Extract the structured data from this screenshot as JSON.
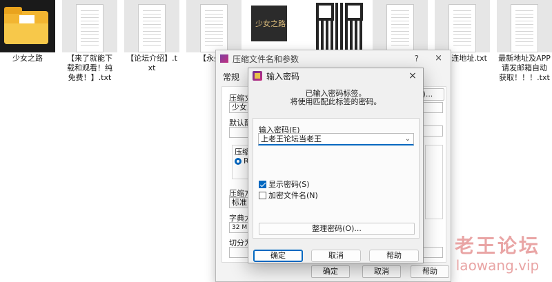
{
  "desktop": {
    "files": [
      {
        "name": "少女之路",
        "kind": "folder"
      },
      {
        "name": "【来了就能下载和观看！纯免费！】.txt",
        "kind": "txt"
      },
      {
        "name": "【论坛介绍】.txt",
        "kind": "txt"
      },
      {
        "name": "【永久地址发布页】.txt",
        "label_visible": "【永久地",
        "kind": "txt"
      },
      {
        "name": "poster",
        "kind": "image"
      },
      {
        "name": "qr",
        "kind": "image"
      },
      {
        "name": "",
        "kind": "txt"
      },
      {
        "name": "连地址.txt",
        "kind": "txt"
      },
      {
        "name": "最新地址及APP请发邮箱自动获取！！！.txt",
        "kind": "txt"
      }
    ],
    "poster_text": "少女之路"
  },
  "back_dialog": {
    "title": "压缩文件名和参数",
    "help_glyph": "?",
    "close_glyph": "×",
    "tab": "常规",
    "archive_label": "压缩文",
    "archive_value": "少女之",
    "browse_button": "(B)...",
    "profile_label": "默认配",
    "format_label": "压缩文",
    "format_radio": "RA",
    "method_label": "压缩方",
    "method_value": "标准",
    "dict_label": "字典大",
    "dict_value": "32 MB",
    "split_label": "切分为",
    "ok": "确定",
    "cancel": "取消",
    "help": "帮助"
  },
  "dialog": {
    "title": "输入密码",
    "close_glyph": "×",
    "message_line1": "已输入密码标签。",
    "message_line2": "将使用匹配此标签的密码。",
    "password_label": "输入密码(E)",
    "password_value": "上老王论坛当老王",
    "show_password": "显示密码(S)",
    "show_password_checked": true,
    "encrypt_names": "加密文件名(N)",
    "encrypt_names_checked": false,
    "manage_button": "整理密码(O)...",
    "ok": "确定",
    "cancel": "取消",
    "help": "帮助"
  },
  "watermark": {
    "name": "老王论坛",
    "url": "laowang.vip",
    "color": "#e9a5a5"
  }
}
